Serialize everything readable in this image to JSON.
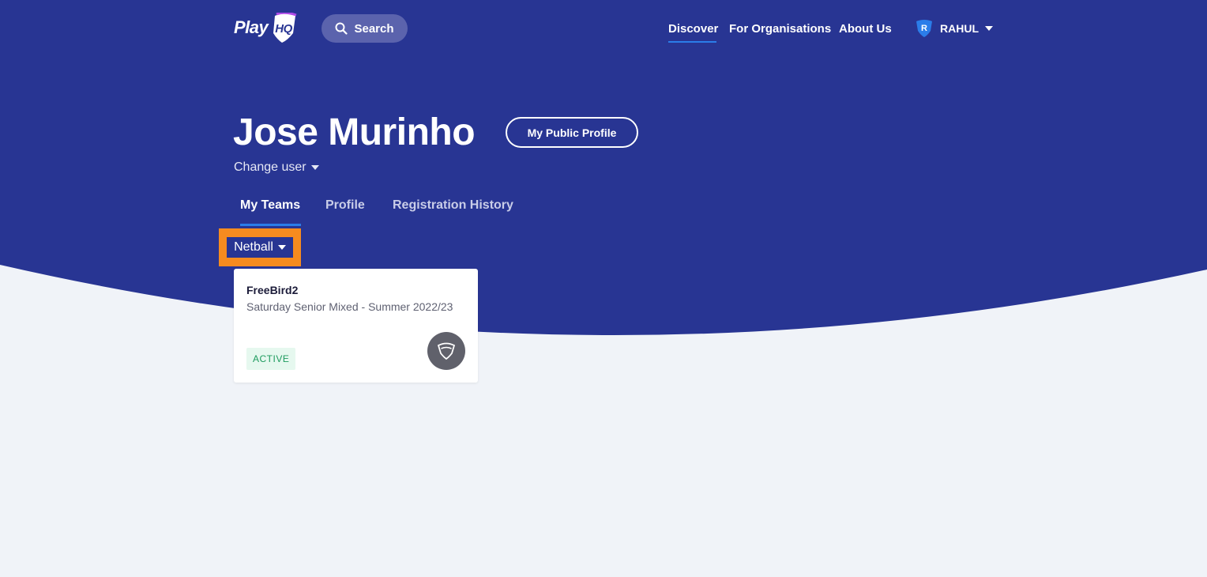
{
  "colors": {
    "hero_background": "#283593",
    "page_background": "#f0f3f8",
    "accent_underline": "#2b7de9",
    "highlight": "#f68b1f",
    "active_badge_text": "#1e9b5e"
  },
  "header": {
    "logo": {
      "text": "PlayHQ",
      "play": "Play",
      "hq": "HQ"
    },
    "search_label": "Search",
    "nav": [
      {
        "label": "Discover",
        "active": true
      },
      {
        "label": "For Organisations",
        "active": false
      },
      {
        "label": "About Us",
        "active": false
      }
    ],
    "user": {
      "avatar_letter": "R",
      "name": "RAHUL"
    }
  },
  "profile": {
    "name": "Jose Murinho",
    "public_profile_button": "My Public Profile",
    "change_user_label": "Change user"
  },
  "tabs": [
    {
      "label": "My Teams",
      "active": true
    },
    {
      "label": "Profile",
      "active": false
    },
    {
      "label": "Registration History",
      "active": false
    }
  ],
  "sport_filter": {
    "selected": "Netball"
  },
  "teams": [
    {
      "name": "FreeBird2",
      "competition": "Saturday Senior Mixed - Summer 2022/23",
      "status": "ACTIVE",
      "icon": "shield-icon"
    }
  ]
}
